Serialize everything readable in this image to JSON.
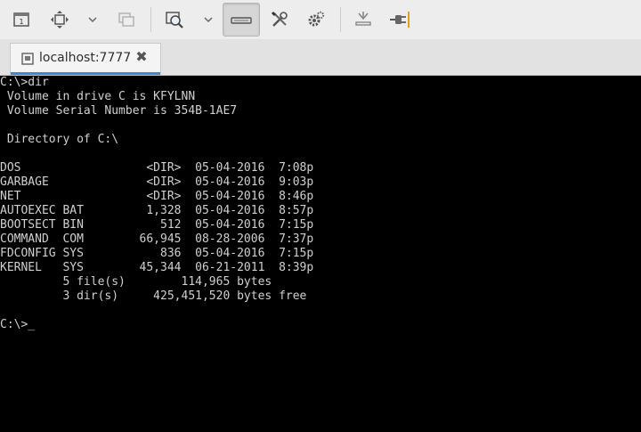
{
  "toolbar": {
    "buttons": [
      {
        "name": "display-icon"
      },
      {
        "name": "fit-window-icon"
      },
      {
        "name": "chevron-down-icon"
      },
      {
        "name": "windows-icon"
      },
      {
        "name": "zoom-icon"
      },
      {
        "name": "chevron-down-icon"
      },
      {
        "name": "keyboard-icon"
      },
      {
        "name": "tools-icon"
      },
      {
        "name": "settings-gear-icon"
      },
      {
        "name": "download-icon"
      },
      {
        "name": "disconnect-plug-icon"
      }
    ]
  },
  "tab": {
    "label": "localhost:7777",
    "close_glyph": "✖"
  },
  "terminal": {
    "lines": [
      "C:\\>dir",
      " Volume in drive C is KFYLNN",
      " Volume Serial Number is 354B-1AE7",
      "",
      " Directory of C:\\",
      "",
      "DOS                  <DIR>  05-04-2016  7:08p",
      "GARBAGE              <DIR>  05-04-2016  9:03p",
      "NET                  <DIR>  05-04-2016  8:46p",
      "AUTOEXEC BAT         1,328  05-04-2016  8:57p",
      "BOOTSECT BIN           512  05-04-2016  7:15p",
      "COMMAND  COM        66,945  08-28-2006  7:37p",
      "FDCONFIG SYS           836  05-04-2016  7:15p",
      "KERNEL   SYS        45,344  06-21-2011  8:39p",
      "         5 file(s)        114,965 bytes",
      "         3 dir(s)     425,451,520 bytes free",
      "",
      "C:\\>_"
    ]
  },
  "colors": {
    "terminal_bg": "#000000",
    "terminal_fg": "#d0d0d0",
    "toolbar_bg": "#ededed",
    "tab_accent": "#3d87d8"
  }
}
